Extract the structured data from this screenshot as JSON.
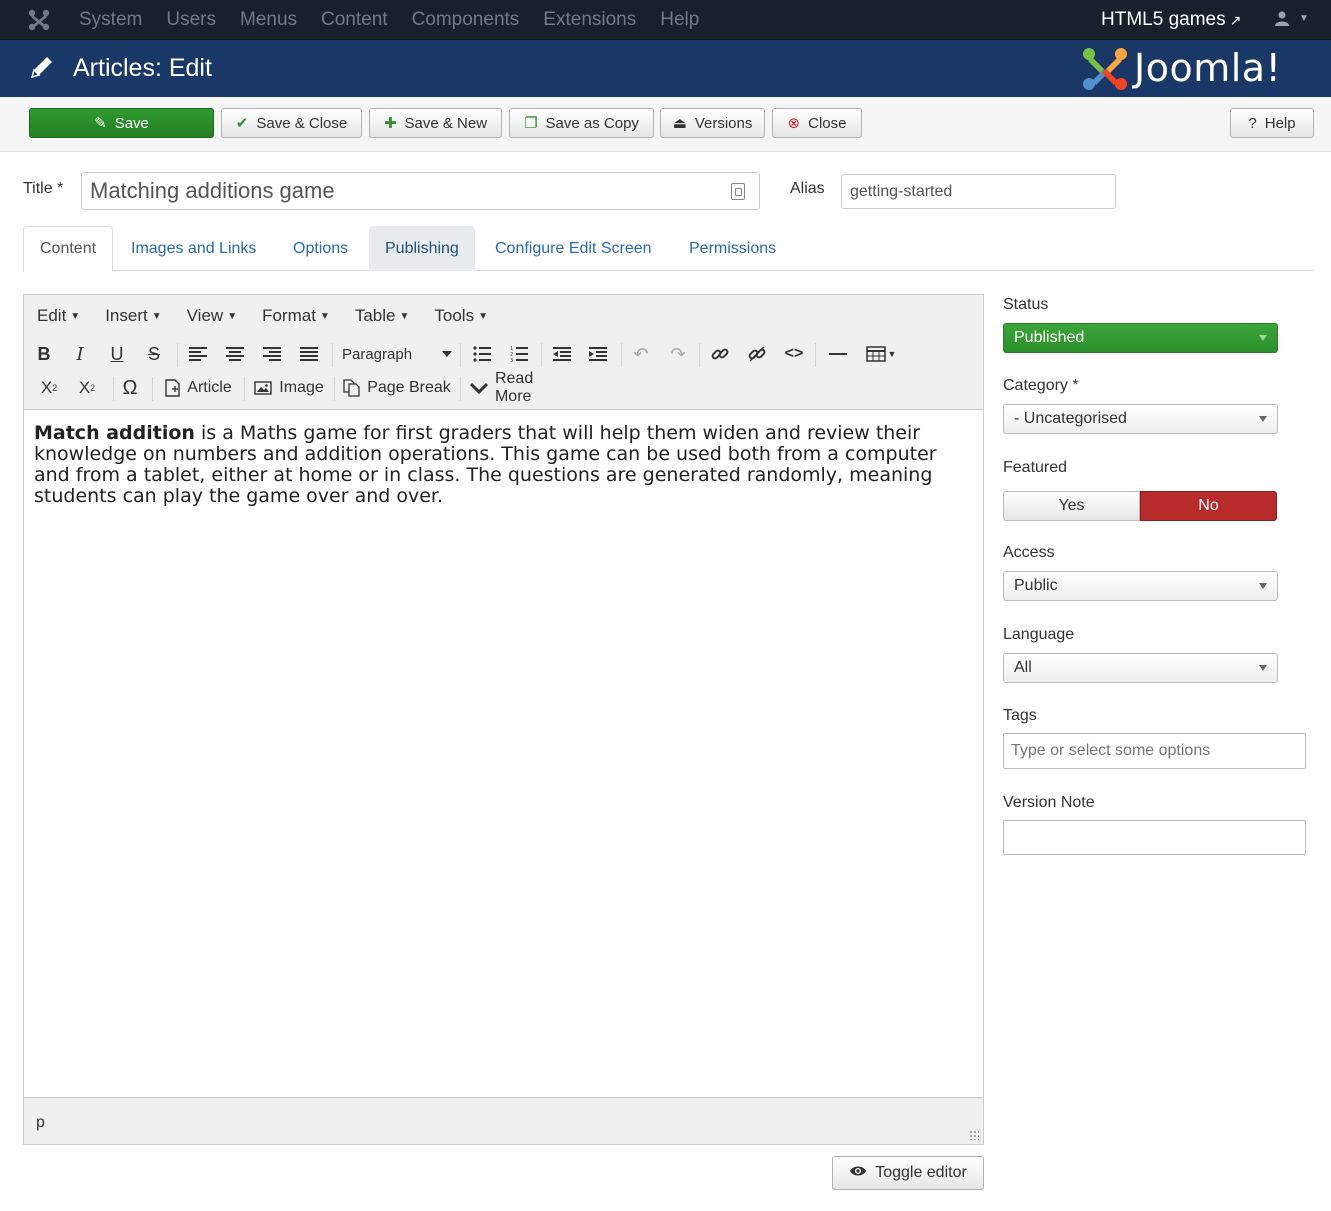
{
  "navbar": {
    "menu": [
      "System",
      "Users",
      "Menus",
      "Content",
      "Components",
      "Extensions",
      "Help"
    ],
    "site_name": "HTML5 games",
    "user_icon": "user-icon"
  },
  "header": {
    "title": "Articles: Edit",
    "brand": "Joomla!"
  },
  "toolbar": {
    "save": "Save",
    "save_close": "Save & Close",
    "save_new": "Save & New",
    "save_copy": "Save as Copy",
    "versions": "Versions",
    "close": "Close",
    "help": "Help"
  },
  "form": {
    "title_label": "Title *",
    "title_value": "Matching additions game",
    "alias_label": "Alias",
    "alias_value": "getting-started"
  },
  "tabs": [
    "Content",
    "Images and Links",
    "Options",
    "Publishing",
    "Configure Edit Screen",
    "Permissions"
  ],
  "editor": {
    "menubar": [
      "Edit",
      "Insert",
      "View",
      "Format",
      "Table",
      "Tools"
    ],
    "format_select": "Paragraph",
    "buttons": {
      "article": "Article",
      "image": "Image",
      "page_break": "Page Break",
      "read_more": "Read More"
    },
    "content_bold": "Match addition",
    "content_rest": " is a Maths game for first graders that will help them widen and review their knowledge on numbers and addition operations. This game can be used both from a computer and from a tablet, either at home or in class. The questions are generated randomly, meaning students can play the game over and over.",
    "path": "p",
    "toggle_editor": "Toggle editor"
  },
  "sidebar": {
    "status_label": "Status",
    "status_value": "Published",
    "category_label": "Category *",
    "category_value": "- Uncategorised",
    "featured_label": "Featured",
    "featured_yes": "Yes",
    "featured_no": "No",
    "access_label": "Access",
    "access_value": "Public",
    "language_label": "Language",
    "language_value": "All",
    "tags_label": "Tags",
    "tags_placeholder": "Type or select some options",
    "version_note_label": "Version Note",
    "version_note_value": ""
  },
  "colors": {
    "navbar": "#17202b",
    "header": "#1a3867",
    "save_green": "#2f9a2f",
    "featured_no_red": "#b72b2b",
    "link_blue": "#2a69b8"
  }
}
